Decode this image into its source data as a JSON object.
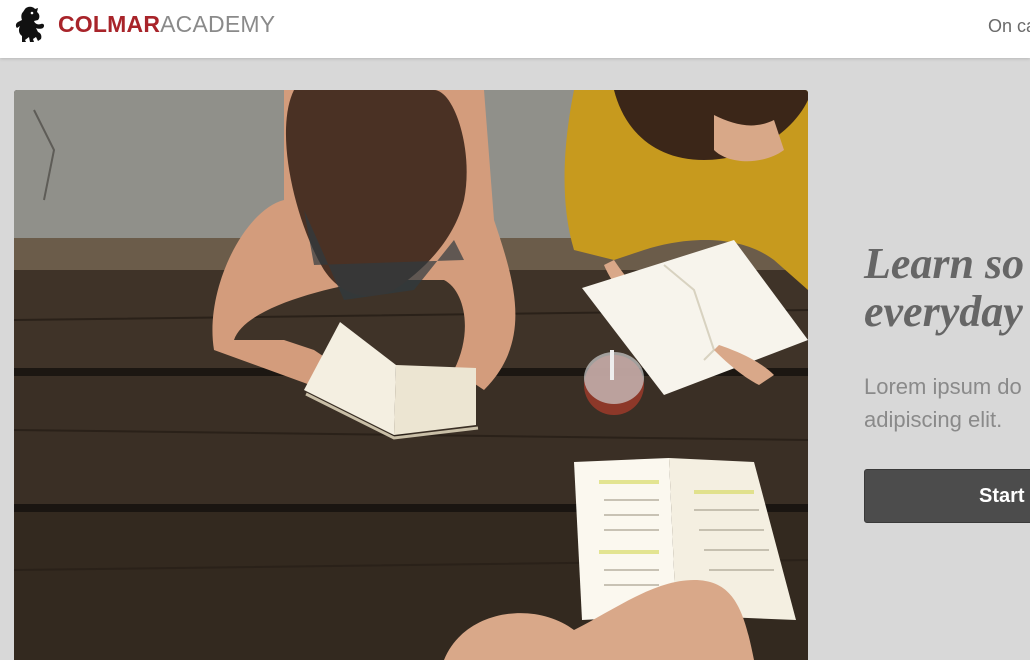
{
  "header": {
    "logo_primary": "COLMAR",
    "logo_secondary": "ACADEMY",
    "nav": [
      {
        "label": "On ca"
      }
    ]
  },
  "hero": {
    "headline_lines": [
      "Learn so",
      "everyday"
    ],
    "subtext_lines": [
      "Lorem ipsum do",
      "adipiscing elit."
    ],
    "cta_label": "Start l"
  },
  "colors": {
    "brand_red": "#a8242a",
    "logo_gray": "#8a8a8a",
    "background": "#d8d8d8",
    "cta_bg": "#4c4c4c"
  },
  "icons": {
    "logo": "lion-rampant-icon"
  }
}
